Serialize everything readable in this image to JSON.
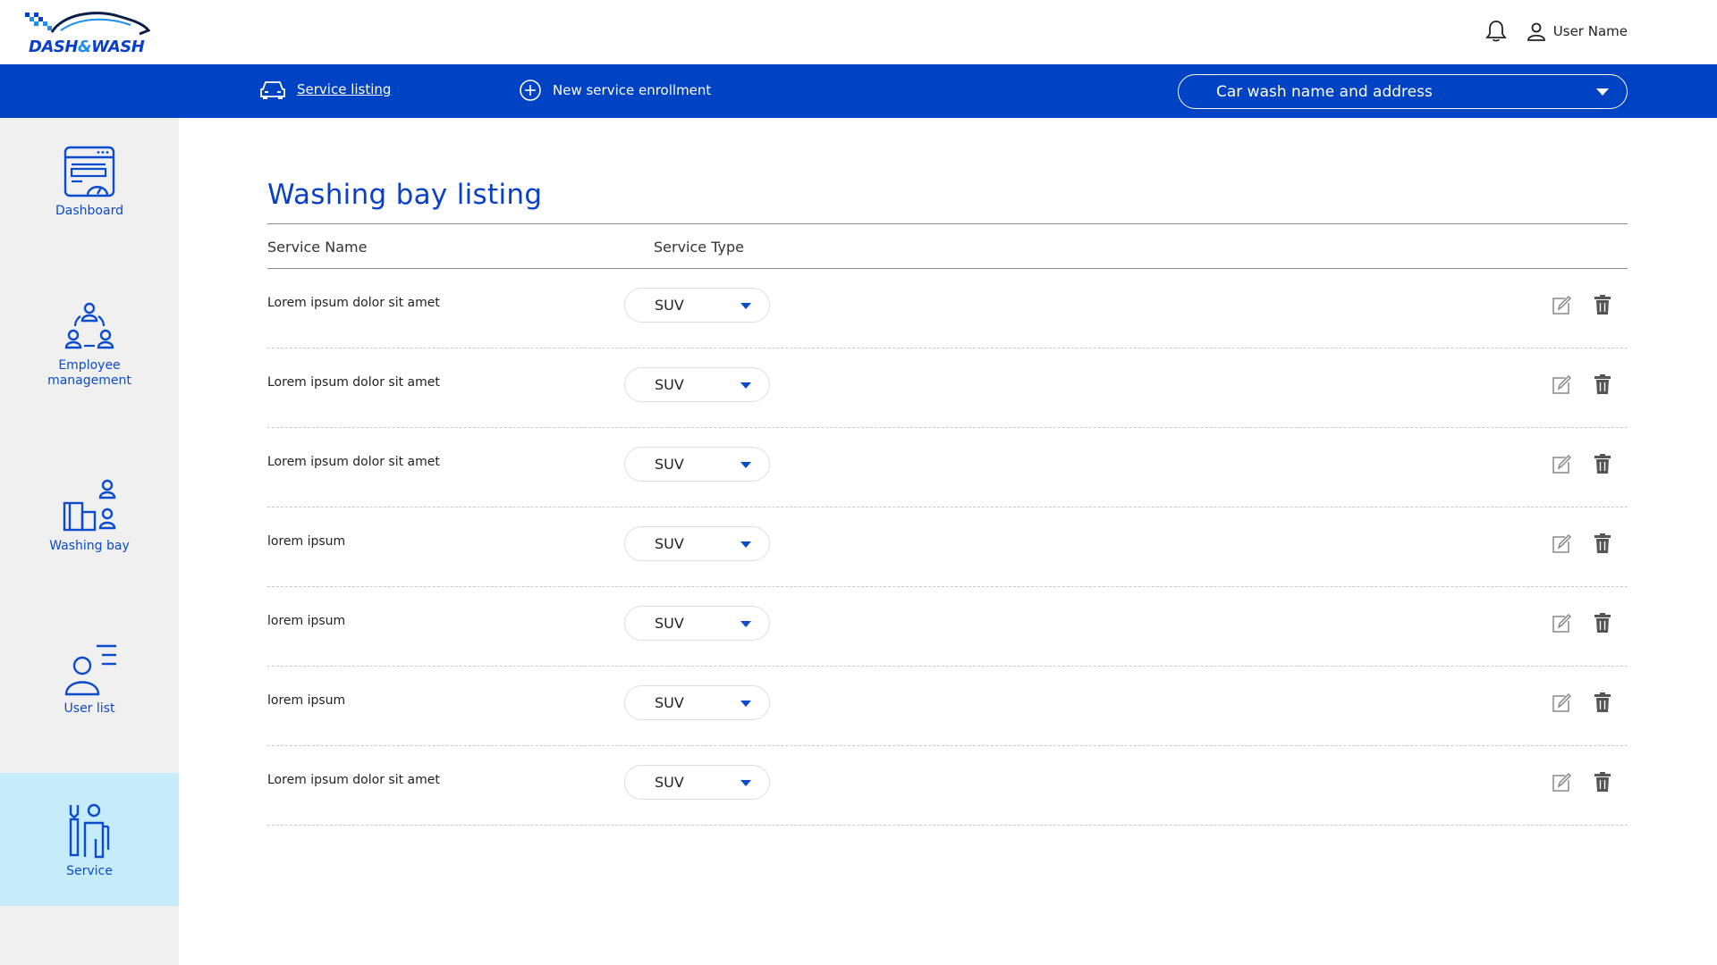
{
  "brand": {
    "logo_text_left": "DASH",
    "logo_amp": "&",
    "logo_text_right": "WASH",
    "primary_color": "#0042c4",
    "accent_color": "#1e8ff0"
  },
  "header": {
    "notification_icon": "bell-icon",
    "user_icon": "user-icon",
    "user_name": "User Name"
  },
  "navbar": {
    "service_listing": {
      "label": "Service listing",
      "icon": "car-icon"
    },
    "new_enrollment": {
      "label": "New service enrollment",
      "icon": "plus-circle-icon"
    },
    "carwash_select": {
      "placeholder": "Car wash name and address"
    }
  },
  "sidebar": {
    "items": [
      {
        "label": "Dashboard",
        "icon": "dashboard-icon"
      },
      {
        "label": "Employee management",
        "icon": "employee-management-icon"
      },
      {
        "label": "Washing bay",
        "icon": "washing-bay-icon"
      },
      {
        "label": "User list",
        "icon": "user-list-icon"
      },
      {
        "label": "Service",
        "icon": "service-icon",
        "active": true
      }
    ]
  },
  "main": {
    "title": "Washing bay listing",
    "columns": [
      "Service Name",
      "Service Type"
    ],
    "rows": [
      {
        "name": "Lorem ipsum dolor sit amet",
        "type": "SUV"
      },
      {
        "name": "Lorem ipsum dolor sit amet",
        "type": "SUV"
      },
      {
        "name": "Lorem ipsum dolor sit amet",
        "type": "SUV"
      },
      {
        "name": "lorem ipsum",
        "type": "SUV"
      },
      {
        "name": "lorem ipsum",
        "type": "SUV"
      },
      {
        "name": "lorem ipsum",
        "type": "SUV"
      },
      {
        "name": "Lorem ipsum dolor sit amet",
        "type": "SUV"
      }
    ],
    "row_actions": {
      "edit_icon": "edit-icon",
      "delete_icon": "trash-icon"
    }
  }
}
